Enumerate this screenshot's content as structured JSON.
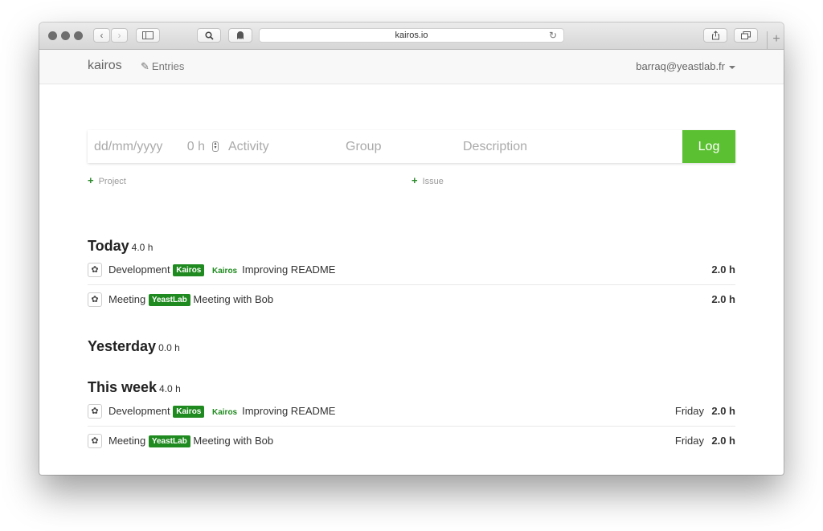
{
  "browser": {
    "url": "kairos.io",
    "back_glyph": "‹",
    "forward_glyph": "›"
  },
  "navbar": {
    "brand": "kairos",
    "entries_label": "Entries",
    "user_email": "barraq@yeastlab.fr"
  },
  "form": {
    "date_placeholder": "dd/mm/yyyy",
    "hours_placeholder": "0 h",
    "activity_placeholder": "Activity",
    "group_placeholder": "Group",
    "description_placeholder": "Description",
    "log_button": "Log",
    "add_project": "Project",
    "add_issue": "Issue"
  },
  "sections": {
    "today": {
      "title": "Today",
      "total": "4.0 h",
      "entries": [
        {
          "activity": "Development",
          "group": "Kairos",
          "issue": "Kairos",
          "description": "Improving README",
          "hours": "2.0 h"
        },
        {
          "activity": "Meeting",
          "group": "YeastLab",
          "description": "Meeting with Bob",
          "hours": "2.0 h"
        }
      ]
    },
    "yesterday": {
      "title": "Yesterday",
      "total": "0.0 h"
    },
    "week": {
      "title": "This week",
      "total": "4.0 h",
      "entries": [
        {
          "activity": "Development",
          "group": "Kairos",
          "issue": "Kairos",
          "description": "Improving README",
          "day": "Friday",
          "hours": "2.0 h"
        },
        {
          "activity": "Meeting",
          "group": "YeastLab",
          "description": "Meeting with Bob",
          "day": "Friday",
          "hours": "2.0 h"
        }
      ]
    }
  },
  "colors": {
    "accent_green": "#5cc132",
    "badge_green": "#1f8a1f"
  }
}
